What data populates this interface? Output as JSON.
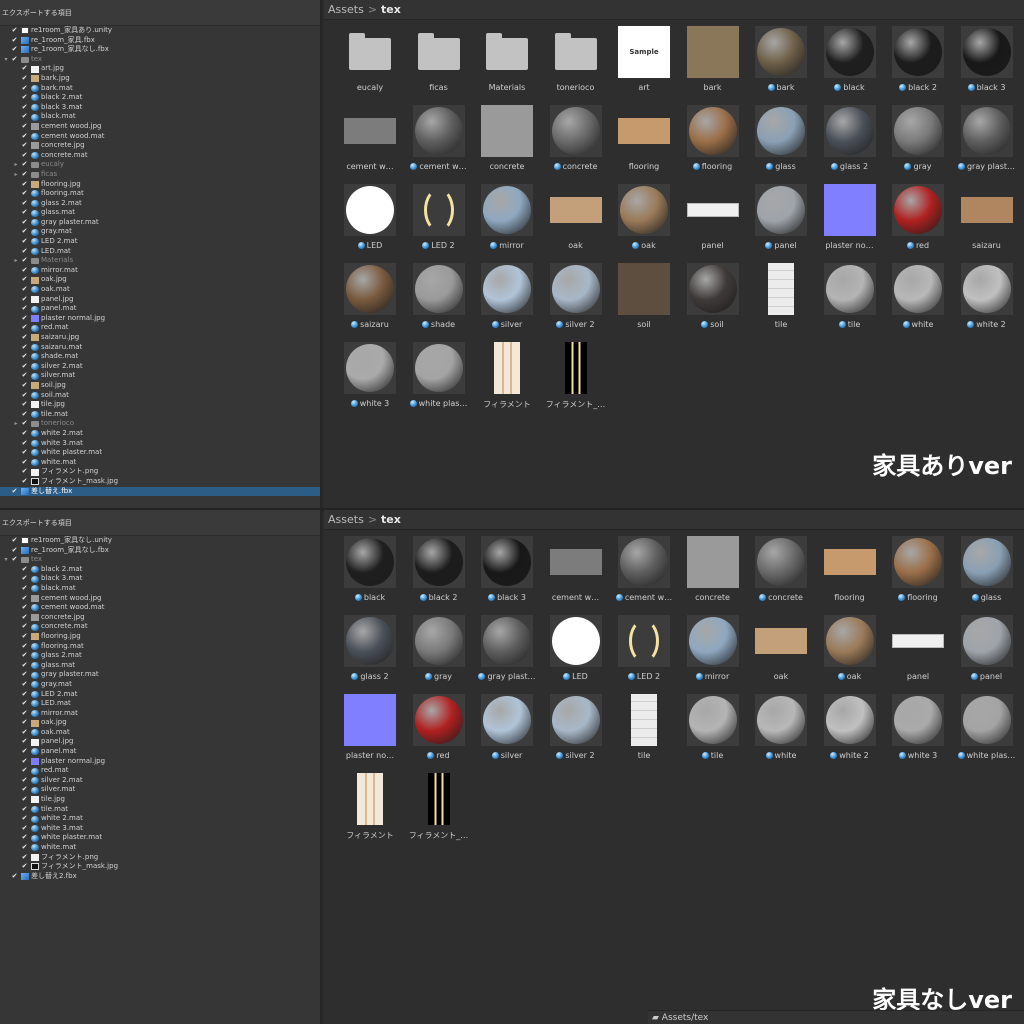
{
  "top": {
    "tree_title": "エクスポートする項目",
    "breadcrumb": {
      "root": "Assets",
      "current": "tex"
    },
    "badge": "家具ありver",
    "tree": [
      {
        "label": "re1room_家具あり.unity",
        "icon": "unity",
        "depth": 0
      },
      {
        "label": "re_1room_家具.fbx",
        "icon": "fbx",
        "depth": 0
      },
      {
        "label": "re_1room_家具なし.fbx",
        "icon": "fbx",
        "depth": 0
      },
      {
        "label": "tex",
        "icon": "folder",
        "depth": 0,
        "fold": "▼",
        "dim": true
      },
      {
        "label": "art.jpg",
        "icon": "imgw",
        "depth": 1
      },
      {
        "label": "bark.jpg",
        "icon": "img",
        "depth": 1
      },
      {
        "label": "bark.mat",
        "icon": "mat",
        "depth": 1
      },
      {
        "label": "black 2.mat",
        "icon": "mat",
        "depth": 1
      },
      {
        "label": "black 3.mat",
        "icon": "mat",
        "depth": 1
      },
      {
        "label": "black.mat",
        "icon": "mat",
        "depth": 1
      },
      {
        "label": "cement wood.jpg",
        "icon": "imgg",
        "depth": 1
      },
      {
        "label": "cement wood.mat",
        "icon": "mat",
        "depth": 1
      },
      {
        "label": "concrete.jpg",
        "icon": "imgg",
        "depth": 1
      },
      {
        "label": "concrete.mat",
        "icon": "mat",
        "depth": 1
      },
      {
        "label": "eucaly",
        "icon": "folder",
        "depth": 1,
        "fold": "▶",
        "dim": true
      },
      {
        "label": "ficas",
        "icon": "folder",
        "depth": 1,
        "fold": "▶",
        "dim": true
      },
      {
        "label": "flooring.jpg",
        "icon": "img",
        "depth": 1
      },
      {
        "label": "flooring.mat",
        "icon": "mat",
        "depth": 1
      },
      {
        "label": "glass 2.mat",
        "icon": "mat",
        "depth": 1
      },
      {
        "label": "glass.mat",
        "icon": "mat",
        "depth": 1
      },
      {
        "label": "gray plaster.mat",
        "icon": "mat",
        "depth": 1
      },
      {
        "label": "gray.mat",
        "icon": "mat",
        "depth": 1
      },
      {
        "label": "LED 2.mat",
        "icon": "mat",
        "depth": 1
      },
      {
        "label": "LED.mat",
        "icon": "mat",
        "depth": 1
      },
      {
        "label": "Materials",
        "icon": "folder",
        "depth": 1,
        "fold": "▶",
        "dim": true
      },
      {
        "label": "mirror.mat",
        "icon": "mat",
        "depth": 1
      },
      {
        "label": "oak.jpg",
        "icon": "img",
        "depth": 1
      },
      {
        "label": "oak.mat",
        "icon": "mat",
        "depth": 1
      },
      {
        "label": "panel.jpg",
        "icon": "imgw",
        "depth": 1
      },
      {
        "label": "panel.mat",
        "icon": "mat",
        "depth": 1
      },
      {
        "label": "plaster normal.jpg",
        "icon": "imgb",
        "depth": 1
      },
      {
        "label": "red.mat",
        "icon": "mat",
        "depth": 1
      },
      {
        "label": "saizaru.jpg",
        "icon": "img",
        "depth": 1
      },
      {
        "label": "saizaru.mat",
        "icon": "mat",
        "depth": 1
      },
      {
        "label": "shade.mat",
        "icon": "mat",
        "depth": 1
      },
      {
        "label": "silver 2.mat",
        "icon": "mat",
        "depth": 1
      },
      {
        "label": "silver.mat",
        "icon": "mat",
        "depth": 1
      },
      {
        "label": "soil.jpg",
        "icon": "img",
        "depth": 1
      },
      {
        "label": "soil.mat",
        "icon": "mat",
        "depth": 1
      },
      {
        "label": "tile.jpg",
        "icon": "imgw",
        "depth": 1
      },
      {
        "label": "tile.mat",
        "icon": "mat",
        "depth": 1
      },
      {
        "label": "tonerioco",
        "icon": "folder",
        "depth": 1,
        "fold": "▶",
        "dim": true
      },
      {
        "label": "white 2.mat",
        "icon": "mat",
        "depth": 1
      },
      {
        "label": "white 3.mat",
        "icon": "mat",
        "depth": 1
      },
      {
        "label": "white plaster.mat",
        "icon": "mat",
        "depth": 1
      },
      {
        "label": "white.mat",
        "icon": "mat",
        "depth": 1
      },
      {
        "label": "フィラメント.png",
        "icon": "imgw",
        "depth": 1
      },
      {
        "label": "フィラメント_mask.jpg",
        "icon": "imgl",
        "depth": 1
      },
      {
        "label": "差し替え.fbx",
        "icon": "fbx",
        "depth": 0,
        "selected": true
      }
    ],
    "assets": [
      {
        "label": "eucaly",
        "kind": "folder"
      },
      {
        "label": "ficas",
        "kind": "folder"
      },
      {
        "label": "Materials",
        "kind": "folder"
      },
      {
        "label": "tonerioco",
        "kind": "folder"
      },
      {
        "label": "art",
        "kind": "art"
      },
      {
        "label": "bark",
        "kind": "tex",
        "color": "#8a7658"
      },
      {
        "label": "bark",
        "kind": "mat",
        "color": "#6e6048"
      },
      {
        "label": "black",
        "kind": "mat",
        "color": "#1f1f1f"
      },
      {
        "label": "black 2",
        "kind": "mat",
        "color": "#1c1c1c"
      },
      {
        "label": "black 3",
        "kind": "mat",
        "color": "#181818"
      },
      {
        "label": "cement w…",
        "kind": "flat",
        "color": "#7c7c7c"
      },
      {
        "label": "cement w…",
        "kind": "mat",
        "color": "#5e5e5e"
      },
      {
        "label": "concrete",
        "kind": "tex",
        "color": "#9a9a9a"
      },
      {
        "label": "concrete",
        "kind": "mat",
        "color": "#6a6a6a"
      },
      {
        "label": "flooring",
        "kind": "flat",
        "color": "#c79a6e"
      },
      {
        "label": "flooring",
        "kind": "mat",
        "color": "#9a6e48"
      },
      {
        "label": "glass",
        "kind": "mat",
        "color": "#8aa0b4"
      },
      {
        "label": "glass 2",
        "kind": "mat",
        "color": "#4a5058"
      },
      {
        "label": "gray",
        "kind": "mat",
        "color": "#7a7a7a"
      },
      {
        "label": "gray plast…",
        "kind": "mat",
        "color": "#5e5e5e"
      },
      {
        "label": "LED",
        "kind": "mat",
        "color": "#ffffff"
      },
      {
        "label": "LED 2",
        "kind": "led",
        "color": "#3a3a3a"
      },
      {
        "label": "mirror",
        "kind": "mat",
        "color": "#8fa8c0"
      },
      {
        "label": "oak",
        "kind": "flat",
        "color": "#c4a07a"
      },
      {
        "label": "oak",
        "kind": "mat",
        "color": "#9a7a58"
      },
      {
        "label": "panel",
        "kind": "panel",
        "color": "#f0f0f0"
      },
      {
        "label": "panel",
        "kind": "mat",
        "color": "#9ea4aa"
      },
      {
        "label": "plaster no…",
        "kind": "tex",
        "color": "#7f7fff"
      },
      {
        "label": "red",
        "kind": "mat",
        "color": "#b02020"
      },
      {
        "label": "saizaru",
        "kind": "flat",
        "color": "#b08660"
      },
      {
        "label": "saizaru",
        "kind": "mat",
        "color": "#7a5a3e"
      },
      {
        "label": "shade",
        "kind": "mat",
        "color": "#9a9a9a"
      },
      {
        "label": "silver",
        "kind": "mat",
        "color": "#b0c4d8"
      },
      {
        "label": "silver 2",
        "kind": "mat",
        "color": "#a8b8c8"
      },
      {
        "label": "soil",
        "kind": "tex",
        "color": "#5e4e40"
      },
      {
        "label": "soil",
        "kind": "mat",
        "color": "#3e3a38"
      },
      {
        "label": "tile",
        "kind": "tall",
        "color": "#e8e8e8"
      },
      {
        "label": "tile",
        "kind": "mat",
        "color": "#b4b4b4"
      },
      {
        "label": "white",
        "kind": "mat",
        "color": "#b8b8b8"
      },
      {
        "label": "white 2",
        "kind": "mat",
        "color": "#c0c0c0"
      },
      {
        "label": "white 3",
        "kind": "mat",
        "color": "#aaaaaa"
      },
      {
        "label": "white plas…",
        "kind": "mat",
        "color": "#a4a4a4"
      },
      {
        "label": "フィラメント",
        "kind": "fil",
        "color": "#f4e8d8"
      },
      {
        "label": "フィラメント_…",
        "kind": "filmask",
        "color": "#000000"
      }
    ]
  },
  "bottom": {
    "tree_title": "エクスポートする項目",
    "breadcrumb": {
      "root": "Assets",
      "current": "tex"
    },
    "badge": "家具なしver",
    "footer_path": "Assets/tex",
    "tree": [
      {
        "label": "re1room_家具なし.unity",
        "icon": "unity",
        "depth": 0
      },
      {
        "label": "re_1room_家具なし.fbx",
        "icon": "fbx",
        "depth": 0
      },
      {
        "label": "tex",
        "icon": "folder",
        "depth": 0,
        "fold": "▼",
        "dim": true
      },
      {
        "label": "black 2.mat",
        "icon": "mat",
        "depth": 1
      },
      {
        "label": "black 3.mat",
        "icon": "mat",
        "depth": 1
      },
      {
        "label": "black.mat",
        "icon": "mat",
        "depth": 1
      },
      {
        "label": "cement wood.jpg",
        "icon": "imgg",
        "depth": 1
      },
      {
        "label": "cement wood.mat",
        "icon": "mat",
        "depth": 1
      },
      {
        "label": "concrete.jpg",
        "icon": "imgg",
        "depth": 1
      },
      {
        "label": "concrete.mat",
        "icon": "mat",
        "depth": 1
      },
      {
        "label": "flooring.jpg",
        "icon": "img",
        "depth": 1
      },
      {
        "label": "flooring.mat",
        "icon": "mat",
        "depth": 1
      },
      {
        "label": "glass 2.mat",
        "icon": "mat",
        "depth": 1
      },
      {
        "label": "glass.mat",
        "icon": "mat",
        "depth": 1
      },
      {
        "label": "gray plaster.mat",
        "icon": "mat",
        "depth": 1
      },
      {
        "label": "gray.mat",
        "icon": "mat",
        "depth": 1
      },
      {
        "label": "LED 2.mat",
        "icon": "mat",
        "depth": 1
      },
      {
        "label": "LED.mat",
        "icon": "mat",
        "depth": 1
      },
      {
        "label": "mirror.mat",
        "icon": "mat",
        "depth": 1
      },
      {
        "label": "oak.jpg",
        "icon": "img",
        "depth": 1
      },
      {
        "label": "oak.mat",
        "icon": "mat",
        "depth": 1
      },
      {
        "label": "panel.jpg",
        "icon": "imgw",
        "depth": 1
      },
      {
        "label": "panel.mat",
        "icon": "mat",
        "depth": 1
      },
      {
        "label": "plaster normal.jpg",
        "icon": "imgb",
        "depth": 1
      },
      {
        "label": "red.mat",
        "icon": "mat",
        "depth": 1
      },
      {
        "label": "silver 2.mat",
        "icon": "mat",
        "depth": 1
      },
      {
        "label": "silver.mat",
        "icon": "mat",
        "depth": 1
      },
      {
        "label": "tile.jpg",
        "icon": "imgw",
        "depth": 1
      },
      {
        "label": "tile.mat",
        "icon": "mat",
        "depth": 1
      },
      {
        "label": "white 2.mat",
        "icon": "mat",
        "depth": 1
      },
      {
        "label": "white 3.mat",
        "icon": "mat",
        "depth": 1
      },
      {
        "label": "white plaster.mat",
        "icon": "mat",
        "depth": 1
      },
      {
        "label": "white.mat",
        "icon": "mat",
        "depth": 1
      },
      {
        "label": "フィラメント.png",
        "icon": "imgw",
        "depth": 1
      },
      {
        "label": "フィラメント_mask.jpg",
        "icon": "imgl",
        "depth": 1
      },
      {
        "label": "差し替え2.fbx",
        "icon": "fbx",
        "depth": 0
      }
    ],
    "assets": [
      {
        "label": "black",
        "kind": "mat",
        "color": "#1f1f1f"
      },
      {
        "label": "black 2",
        "kind": "mat",
        "color": "#1c1c1c"
      },
      {
        "label": "black 3",
        "kind": "mat",
        "color": "#181818"
      },
      {
        "label": "cement w…",
        "kind": "flat",
        "color": "#7c7c7c"
      },
      {
        "label": "cement w…",
        "kind": "mat",
        "color": "#5e5e5e"
      },
      {
        "label": "concrete",
        "kind": "tex",
        "color": "#9a9a9a"
      },
      {
        "label": "concrete",
        "kind": "mat",
        "color": "#6a6a6a"
      },
      {
        "label": "flooring",
        "kind": "flat",
        "color": "#c79a6e"
      },
      {
        "label": "flooring",
        "kind": "mat",
        "color": "#9a6e48"
      },
      {
        "label": "glass",
        "kind": "mat",
        "color": "#8aa0b4"
      },
      {
        "label": "glass 2",
        "kind": "mat",
        "color": "#4a5058"
      },
      {
        "label": "gray",
        "kind": "mat",
        "color": "#7a7a7a"
      },
      {
        "label": "gray plast…",
        "kind": "mat",
        "color": "#5e5e5e"
      },
      {
        "label": "LED",
        "kind": "mat",
        "color": "#ffffff"
      },
      {
        "label": "LED 2",
        "kind": "led",
        "color": "#3a3a3a"
      },
      {
        "label": "mirror",
        "kind": "mat",
        "color": "#8fa8c0"
      },
      {
        "label": "oak",
        "kind": "flat",
        "color": "#c4a07a"
      },
      {
        "label": "oak",
        "kind": "mat",
        "color": "#9a7a58"
      },
      {
        "label": "panel",
        "kind": "panel",
        "color": "#f0f0f0"
      },
      {
        "label": "panel",
        "kind": "mat",
        "color": "#9ea4aa"
      },
      {
        "label": "plaster no…",
        "kind": "tex",
        "color": "#7f7fff"
      },
      {
        "label": "red",
        "kind": "mat",
        "color": "#b02020"
      },
      {
        "label": "silver",
        "kind": "mat",
        "color": "#b0c4d8"
      },
      {
        "label": "silver 2",
        "kind": "mat",
        "color": "#a8b8c8"
      },
      {
        "label": "tile",
        "kind": "tall",
        "color": "#e8e8e8"
      },
      {
        "label": "tile",
        "kind": "mat",
        "color": "#b4b4b4"
      },
      {
        "label": "white",
        "kind": "mat",
        "color": "#b8b8b8"
      },
      {
        "label": "white 2",
        "kind": "mat",
        "color": "#c0c0c0"
      },
      {
        "label": "white 3",
        "kind": "mat",
        "color": "#aaaaaa"
      },
      {
        "label": "white plas…",
        "kind": "mat",
        "color": "#a4a4a4"
      },
      {
        "label": "フィラメント",
        "kind": "fil",
        "color": "#f4e8d8"
      },
      {
        "label": "フィラメント_…",
        "kind": "filmask",
        "color": "#000000"
      }
    ]
  }
}
